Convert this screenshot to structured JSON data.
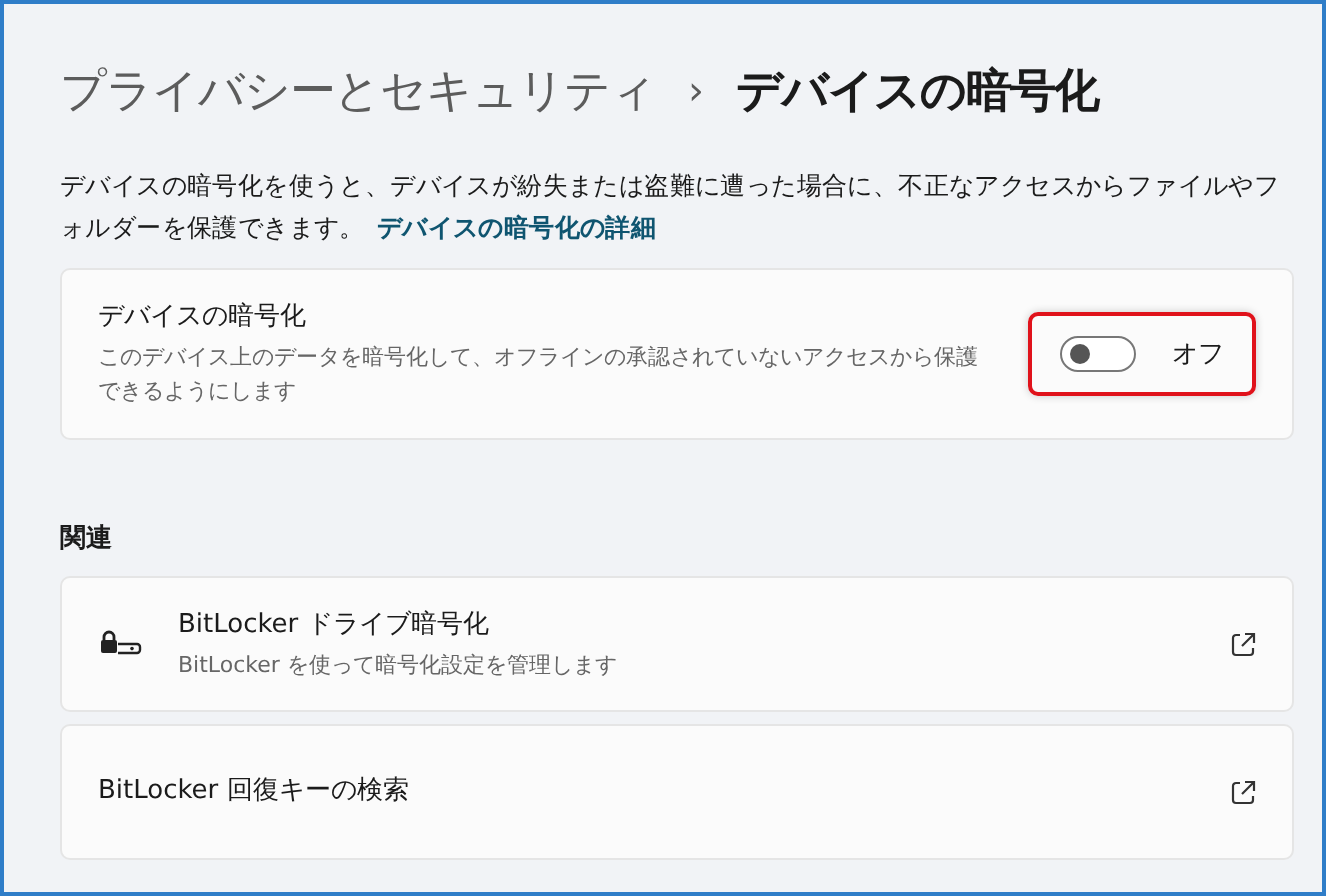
{
  "breadcrumb": {
    "parent": "プライバシーとセキュリティ",
    "separator": "›",
    "current": "デバイスの暗号化"
  },
  "description": {
    "text": "デバイスの暗号化を使うと、デバイスが紛失または盗難に遭った場合に、不正なアクセスからファイルやフォルダーを保護できます。",
    "link": "デバイスの暗号化の詳細"
  },
  "setting": {
    "title": "デバイスの暗号化",
    "subtitle": "このデバイス上のデータを暗号化して、オフラインの承認されていないアクセスから保護できるようにします",
    "on": false,
    "state_label": "オフ",
    "highlighted": true
  },
  "related": {
    "heading": "関連",
    "items": [
      {
        "kind": "icon",
        "title": "BitLocker ドライブ暗号化",
        "subtitle": "BitLocker を使って暗号化設定を管理します"
      },
      {
        "kind": "plain",
        "title": "BitLocker 回復キーの検索"
      }
    ]
  }
}
